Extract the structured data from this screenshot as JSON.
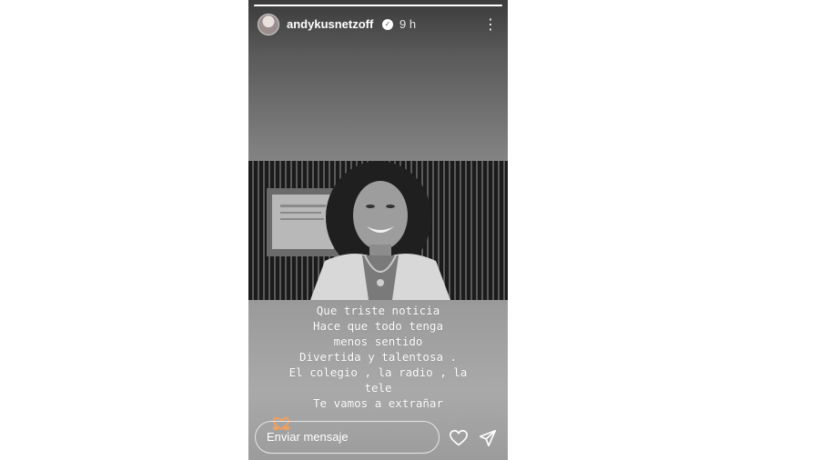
{
  "story": {
    "username": "andykusnetzoff",
    "time": "9 h",
    "progress_fraction": 1.0,
    "caption_lines": [
      "Que triste noticia",
      "Hace que todo tenga",
      "menos sentido",
      "Divertida y talentosa .",
      "El colegio , la radio , la",
      "tele",
      "Te vamos a extrañar"
    ],
    "reaction_emoji_name": "heart-hands-icon",
    "message_placeholder": "Enviar mensaje"
  }
}
